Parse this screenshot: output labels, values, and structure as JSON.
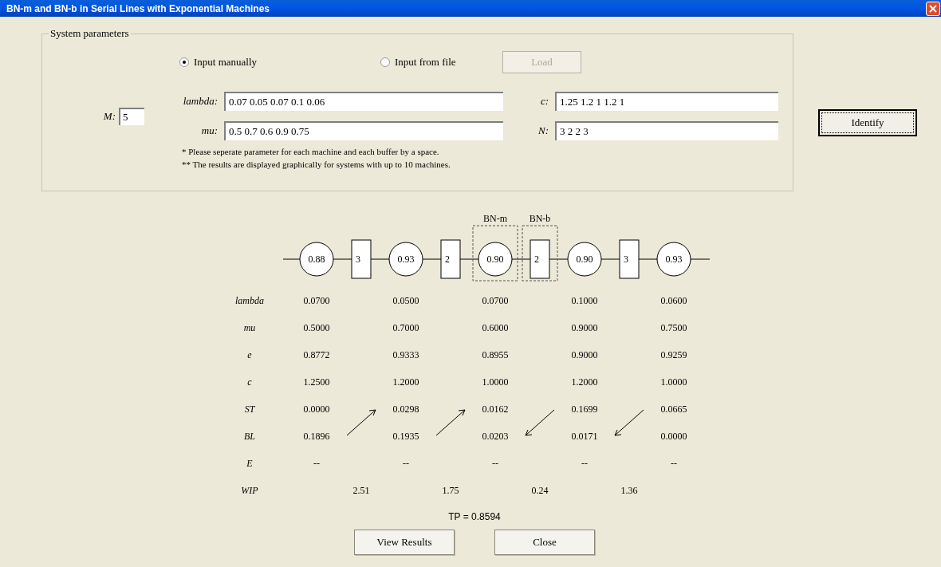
{
  "window": {
    "title": "BN-m and BN-b in Serial Lines with Exponential Machines"
  },
  "system_parameters": {
    "title": "System parameters",
    "input_modes": [
      {
        "label": "Input manually",
        "selected": true
      },
      {
        "label": "Input from file",
        "selected": false
      }
    ],
    "load_button": {
      "label": "Load",
      "disabled": true
    },
    "m": {
      "label": "M:",
      "value": "5"
    },
    "fields": [
      {
        "label": "lambda:",
        "value": "0.07 0.05 0.07 0.1 0.06"
      },
      {
        "label": "c:",
        "value": "1.25 1.2 1 1.2 1"
      },
      {
        "label": "mu:",
        "value": "0.5 0.7 0.6 0.9 0.75"
      },
      {
        "label": "N:",
        "value": "3 2 2 3"
      }
    ],
    "notes": [
      "* Please seperate parameter for each machine and  each buffer by a space.",
      "** The results are displayed graphically for systems with up to 10 machines."
    ]
  },
  "identify_button": "Identify",
  "diagram": {
    "machines": [
      {
        "value": "0.88"
      },
      {
        "value": "0.93"
      },
      {
        "value": "0.90",
        "bottleneck_label": "BN-m"
      },
      {
        "value": "0.90"
      },
      {
        "value": "0.93"
      }
    ],
    "buffers": [
      {
        "value": "3"
      },
      {
        "value": "2"
      },
      {
        "value": "2",
        "bottleneck_label": "BN-b"
      },
      {
        "value": "3"
      }
    ]
  },
  "table": {
    "rows": [
      {
        "label": "lambda",
        "values": [
          "0.0700",
          "0.0500",
          "0.0700",
          "0.1000",
          "0.0600"
        ]
      },
      {
        "label": "mu",
        "values": [
          "0.5000",
          "0.7000",
          "0.6000",
          "0.9000",
          "0.7500"
        ]
      },
      {
        "label": "e",
        "values": [
          "0.8772",
          "0.9333",
          "0.8955",
          "0.9000",
          "0.9259"
        ]
      },
      {
        "label": "c",
        "values": [
          "1.2500",
          "1.2000",
          "1.0000",
          "1.2000",
          "1.0000"
        ]
      },
      {
        "label": "ST",
        "values": [
          "0.0000",
          "0.0298",
          "0.0162",
          "0.1699",
          "0.0665"
        ]
      },
      {
        "label": "BL",
        "values": [
          "0.1896",
          "0.1935",
          "0.0203",
          "0.0171",
          "0.0000"
        ]
      },
      {
        "label": "E",
        "values": [
          "--",
          "--",
          "--",
          "--",
          "--"
        ]
      }
    ],
    "wip": {
      "label": "WIP",
      "values": [
        "2.51",
        "1.75",
        "0.24",
        "1.36"
      ]
    },
    "arrows": [
      {
        "kind": "up"
      },
      {
        "kind": "up"
      },
      {
        "kind": "down"
      },
      {
        "kind": "down"
      }
    ]
  },
  "throughput": "TP = 0.8594",
  "buttons": [
    "View Results",
    "Close"
  ]
}
